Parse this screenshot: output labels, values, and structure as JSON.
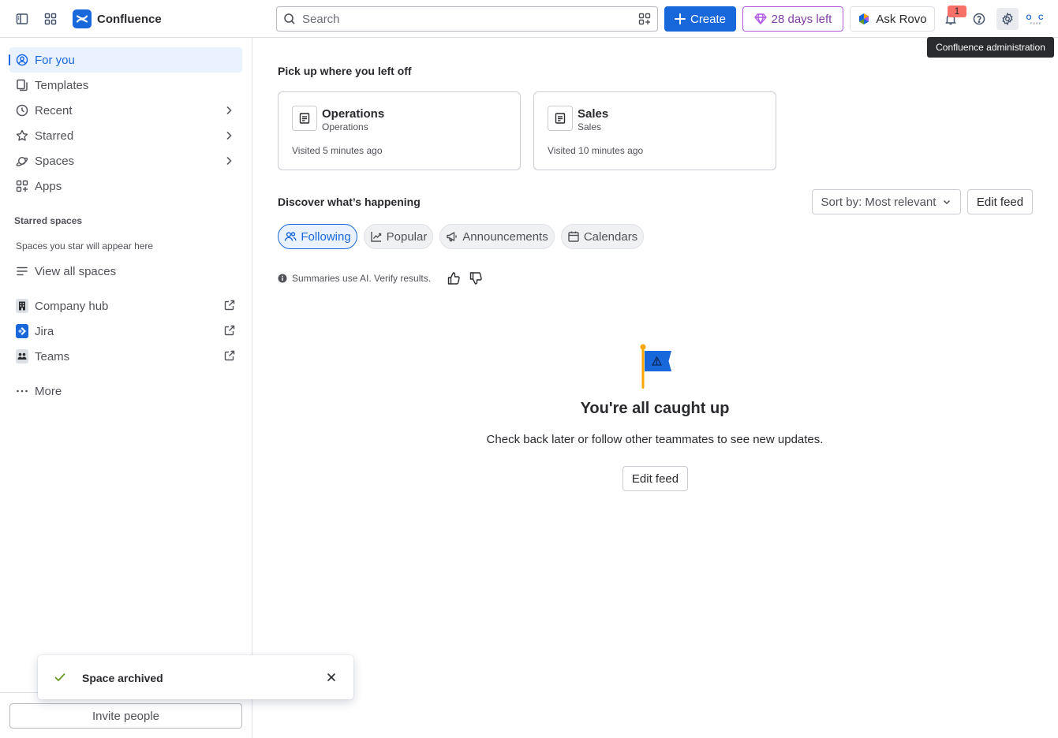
{
  "app": {
    "name": "Confluence"
  },
  "topbar": {
    "search_placeholder": "Search",
    "create_label": "Create",
    "trial_label": "28 days left",
    "rovo_label": "Ask Rovo",
    "notification_count": "1",
    "avatar_initials": "O C",
    "avatar_sub": "PURE"
  },
  "tooltip": {
    "text": "Confluence administration"
  },
  "sidebar": {
    "items": [
      {
        "label": "For you",
        "icon": "person-circle-icon",
        "active": true
      },
      {
        "label": "Templates",
        "icon": "templates-icon"
      },
      {
        "label": "Recent",
        "icon": "clock-icon",
        "expandable": true
      },
      {
        "label": "Starred",
        "icon": "star-icon",
        "expandable": true
      },
      {
        "label": "Spaces",
        "icon": "planet-icon",
        "expandable": true
      },
      {
        "label": "Apps",
        "icon": "apps-grid-icon"
      }
    ],
    "starred_heading": "Starred spaces",
    "starred_hint": "Spaces you star will appear here",
    "view_all": "View all spaces",
    "external_apps": [
      {
        "label": "Company hub",
        "icon": "building-icon"
      },
      {
        "label": "Jira",
        "icon": "jira-icon"
      },
      {
        "label": "Teams",
        "icon": "teams-icon"
      }
    ],
    "more_label": "More",
    "invite_label": "Invite people"
  },
  "main": {
    "pickup_title": "Pick up where you left off",
    "recent_cards": [
      {
        "title": "Operations",
        "space": "Operations",
        "visited": "Visited 5 minutes ago"
      },
      {
        "title": "Sales",
        "space": "Sales",
        "visited": "Visited 10 minutes ago"
      }
    ],
    "discover_title": "Discover what’s happening",
    "sort_label": "Sort by: Most relevant",
    "edit_feed_label": "Edit feed",
    "tabs": [
      {
        "label": "Following",
        "active": true
      },
      {
        "label": "Popular"
      },
      {
        "label": "Announcements"
      },
      {
        "label": "Calendars"
      }
    ],
    "ai_note": "Summaries use AI. Verify results.",
    "empty_title": "You're all caught up",
    "empty_desc": "Check back later or follow other teammates to see new updates.",
    "empty_button": "Edit feed"
  },
  "toast": {
    "message": "Space archived"
  },
  "colors": {
    "brand": "#1868db",
    "accent_trial": "#803fa5",
    "success": "#6a9a23",
    "badge": "#f87168"
  }
}
